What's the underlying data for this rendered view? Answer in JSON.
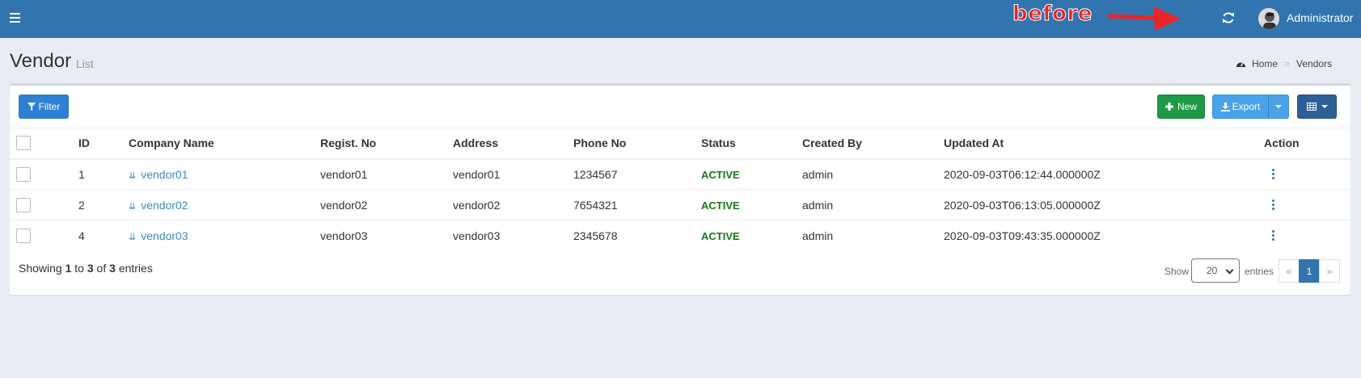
{
  "topbar": {
    "annotation": "before",
    "user_name": "Administrator"
  },
  "header": {
    "title": "Vendor",
    "subtitle": "List",
    "breadcrumb": [
      "Home",
      "Vendors"
    ]
  },
  "toolbar": {
    "filter_label": "Filter",
    "new_label": "New",
    "export_label": "Export"
  },
  "table": {
    "columns": [
      "ID",
      "Company Name",
      "Regist. No",
      "Address",
      "Phone No",
      "Status",
      "Created By",
      "Updated At",
      "Action"
    ],
    "rows": [
      {
        "id": "1",
        "company": "vendor01",
        "regist": "vendor01",
        "address": "vendor01",
        "phone": "1234567",
        "status": "ACTIVE",
        "created_by": "admin",
        "updated_at": "2020-09-03T06:12:44.000000Z"
      },
      {
        "id": "2",
        "company": "vendor02",
        "regist": "vendor02",
        "address": "vendor02",
        "phone": "7654321",
        "status": "ACTIVE",
        "created_by": "admin",
        "updated_at": "2020-09-03T06:13:05.000000Z"
      },
      {
        "id": "4",
        "company": "vendor03",
        "regist": "vendor03",
        "address": "vendor03",
        "phone": "2345678",
        "status": "ACTIVE",
        "created_by": "admin",
        "updated_at": "2020-09-03T09:43:35.000000Z"
      }
    ]
  },
  "footer": {
    "showing_prefix": "Showing",
    "from": "1",
    "to_word": "to",
    "to": "3",
    "of_word": "of",
    "total": "3",
    "entries_word": "entries",
    "show_label": "Show",
    "page_size": "20",
    "entries_label": "entries",
    "pager": [
      "«",
      "1",
      "»"
    ]
  },
  "colors": {
    "topbar": "#3275ae",
    "status_active": "#147a14",
    "link": "#3c8dbc",
    "annotation": "#e8252b"
  }
}
